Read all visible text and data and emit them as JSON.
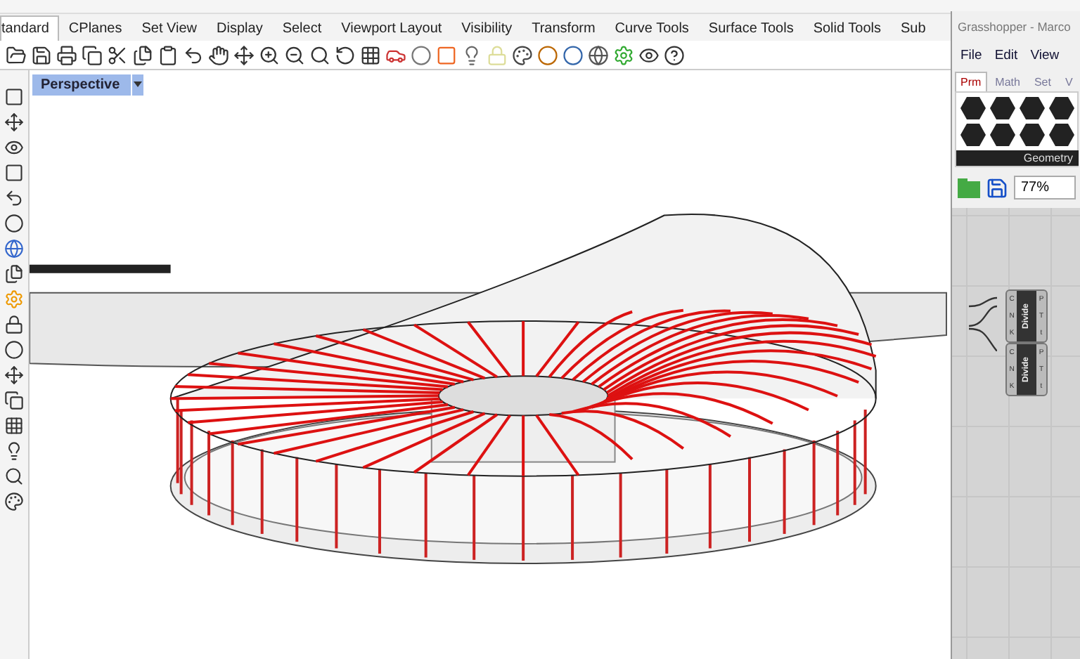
{
  "menu_tabs": [
    {
      "label": "tandard",
      "selected": true
    },
    {
      "label": "CPlanes",
      "selected": false
    },
    {
      "label": "Set View",
      "selected": false
    },
    {
      "label": "Display",
      "selected": false
    },
    {
      "label": "Select",
      "selected": false
    },
    {
      "label": "Viewport Layout",
      "selected": false
    },
    {
      "label": "Visibility",
      "selected": false
    },
    {
      "label": "Transform",
      "selected": false
    },
    {
      "label": "Curve Tools",
      "selected": false
    },
    {
      "label": "Surface Tools",
      "selected": false
    },
    {
      "label": "Solid Tools",
      "selected": false
    },
    {
      "label": "Sub",
      "selected": false
    }
  ],
  "viewport": {
    "title": "Perspective",
    "active": true
  },
  "grasshopper": {
    "title": "Grasshopper - Marco",
    "menu": [
      "File",
      "Edit",
      "View"
    ],
    "tabs": [
      {
        "label": "Prm",
        "selected": true
      },
      {
        "label": "Math",
        "selected": false
      },
      {
        "label": "Set",
        "selected": false
      },
      {
        "label": "V",
        "selected": false
      }
    ],
    "ribbon_group": "Geometry",
    "zoom": "77%",
    "components": [
      {
        "name": "Divide",
        "inputs": [
          "C",
          "N",
          "K"
        ],
        "outputs": [
          "P",
          "T",
          "t"
        ]
      },
      {
        "name": "Divide",
        "inputs": [
          "C",
          "N",
          "K"
        ],
        "outputs": [
          "P",
          "T",
          "t"
        ]
      }
    ]
  }
}
